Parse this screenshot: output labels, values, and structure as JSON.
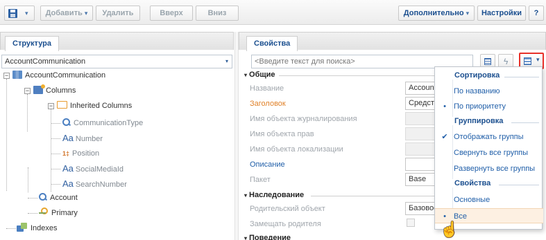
{
  "toolbar": {
    "add_label": "Добавить",
    "delete_label": "Удалить",
    "up_label": "Вверх",
    "down_label": "Вниз",
    "more_label": "Дополнительно",
    "settings_label": "Настройки",
    "dropdown_arrow": "▾",
    "help_symbol": "?"
  },
  "left": {
    "tab": "Структура",
    "object_selector": "AccountCommunication",
    "tree": {
      "root": "AccountCommunication",
      "columns": "Columns",
      "inherited": "Inherited Columns",
      "communication_type": "CommunicationType",
      "number": "Number",
      "position": "Position",
      "social_media_id": "SocialMediaId",
      "search_number": "SearchNumber",
      "account": "Account",
      "primary": "Primary",
      "indexes": "Indexes"
    },
    "icons": {
      "aa": "Aa",
      "num": "1‡",
      "minus": "−"
    }
  },
  "right": {
    "tab": "Свойства",
    "search_placeholder": "<Введите текст для поиска>",
    "sections": {
      "general": "Общие",
      "inheritance": "Наследование",
      "behavior": "Поведение"
    },
    "props": {
      "name_label": "Название",
      "name_value": "AccountCo",
      "caption_label": "Заголовок",
      "caption_value": "Средство",
      "journal_label": "Имя объекта журналирования",
      "rights_label": "Имя объекта прав",
      "localization_label": "Имя объекта локализации",
      "description_label": "Описание",
      "package_label": "Пакет",
      "package_value": "Base",
      "parent_label": "Родительский объект",
      "parent_value": "Базовое",
      "replace_parent_label": "Замещать родителя"
    },
    "section_marker": "▾"
  },
  "menu": {
    "sort_header": "Сортировка",
    "by_name": "По названию",
    "by_priority": "По приоритету",
    "group_header": "Группировка",
    "show_groups": "Отображать группы",
    "collapse_all": "Свернуть все группы",
    "expand_all": "Развернуть все группы",
    "props_header": "Свойства",
    "basic": "Основные",
    "all": "Все",
    "check_mark": "✔",
    "bullet": "•"
  },
  "colors": {
    "accent_blue": "#1b4f8f",
    "link_blue": "#1f5ea8",
    "required_orange": "#e0822a",
    "highlight_red": "#e8312a"
  }
}
